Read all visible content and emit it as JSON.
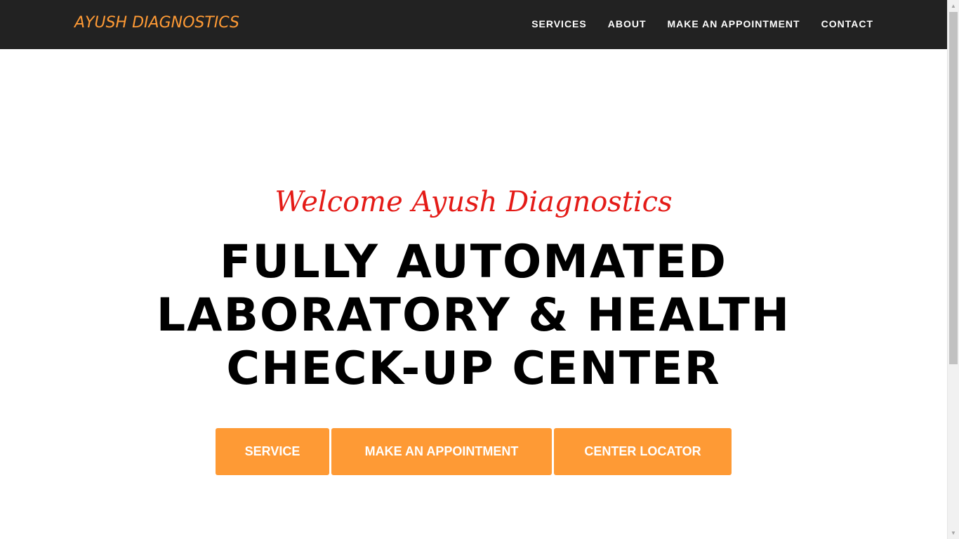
{
  "navbar": {
    "brand": "AYUSH DIAGNOSTICS",
    "links": [
      "SERVICES",
      "ABOUT",
      "MAKE AN APPOINTMENT",
      "CONTACT"
    ]
  },
  "hero": {
    "welcome": "Welcome Ayush Diagnostics",
    "headline_lines": [
      "FULLY AUTOMATED",
      "LABORATORY & HEALTH",
      "CHECK-UP CENTER"
    ],
    "buttons": [
      "SERVICE",
      "MAKE AN APPOINTMENT",
      "CENTER LOCATOR"
    ]
  },
  "colors": {
    "nav_bg": "#222222",
    "brand": "#fe9a35",
    "welcome": "#e41b17",
    "button_bg": "#fe9a35"
  },
  "icons": [
    "scroll-up-arrow-icon",
    "scroll-down-arrow-icon"
  ]
}
